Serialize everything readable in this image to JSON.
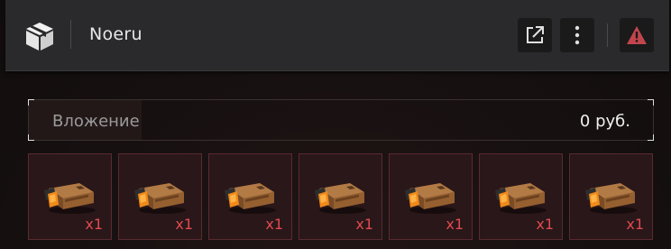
{
  "header": {
    "title": "Noeru",
    "icons": {
      "logo": "box-icon",
      "open": "external-link-icon",
      "menu": "more-vertical-icon",
      "report": "warning-icon"
    },
    "accent_warning": "#c2454d"
  },
  "investment": {
    "label": "Вложение",
    "value": "0 руб."
  },
  "items": [
    {
      "icon": "ammo-crate-icon",
      "qty": "x1"
    },
    {
      "icon": "ammo-crate-icon",
      "qty": "x1"
    },
    {
      "icon": "ammo-crate-icon",
      "qty": "x1"
    },
    {
      "icon": "ammo-crate-icon",
      "qty": "x1"
    },
    {
      "icon": "ammo-crate-icon",
      "qty": "x1"
    },
    {
      "icon": "ammo-crate-icon",
      "qty": "x1"
    },
    {
      "icon": "ammo-crate-icon",
      "qty": "x1"
    }
  ],
  "colors": {
    "item_qty": "#e04a50",
    "item_border": "#5a2a30"
  }
}
